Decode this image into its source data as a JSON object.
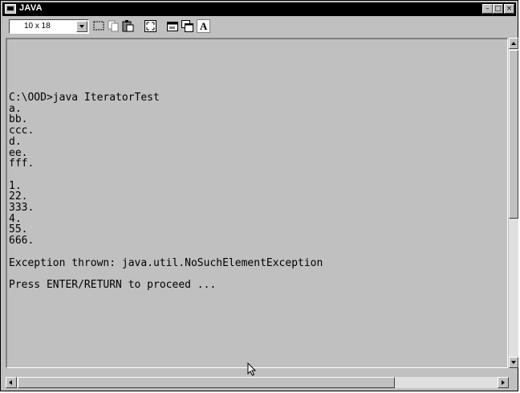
{
  "window": {
    "title": "JAVA",
    "icon": "console-window-icon",
    "controls": [
      "minimize-icon",
      "maximize-icon",
      "close-icon"
    ]
  },
  "toolbar": {
    "font_size": "10 x 18",
    "tools": [
      "mark-icon",
      "copy-icon",
      "paste-icon",
      "fullscreen-icon",
      "properties-icon",
      "background-icon",
      "font-icon"
    ],
    "font_button_label": "A"
  },
  "console": {
    "lines": [
      "C:\\OOD>java IteratorTest",
      "a.",
      "bb.",
      "ccc.",
      "d.",
      "ee.",
      "fff.",
      "",
      "1.",
      "22.",
      "333.",
      "4.",
      "55.",
      "666.",
      "",
      "Exception thrown: java.util.NoSuchElementException",
      "",
      "Press ENTER/RETURN to proceed ..."
    ]
  },
  "colors": {
    "title_bar": "#000000",
    "console_background": "#c0c0c0",
    "text": "#000000"
  }
}
